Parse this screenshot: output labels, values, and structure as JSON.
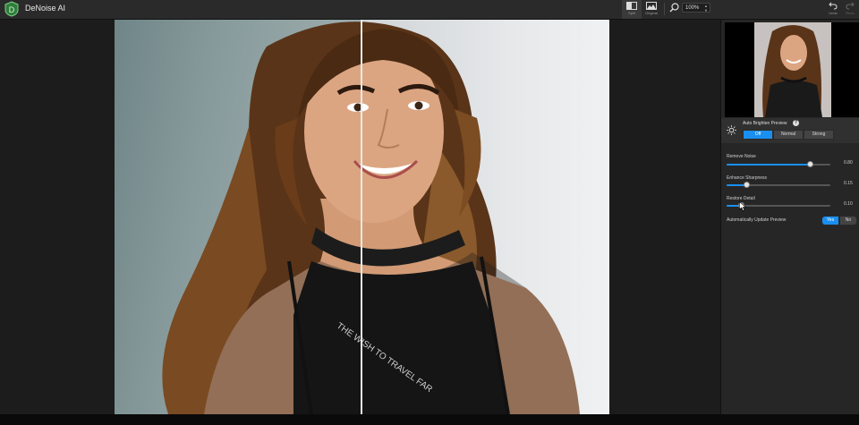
{
  "app": {
    "title": "DeNoise AI"
  },
  "toolbar": {
    "split_label": "Split",
    "original_label": "Original",
    "zoom_value": "100%",
    "undo_label": "Undo",
    "redo_label": "Redo"
  },
  "preview": {
    "shirt_text": "THE WISH TO TRAVEL FAR"
  },
  "panel": {
    "auto_brighten_label": "Auto Brighten Preview",
    "brighten_options": [
      "Off",
      "Normal",
      "Strong"
    ],
    "brighten_selected": "Off",
    "sliders": [
      {
        "label": "Remove Noise",
        "value": "0.80",
        "fraction": 0.8
      },
      {
        "label": "Enhance Sharpness",
        "value": "0.15",
        "fraction": 0.19
      },
      {
        "label": "Restore Detail",
        "value": "0.10",
        "fraction": 0.14
      }
    ],
    "auto_update_label": "Automatically Update Preview",
    "auto_update_yes": "Yes",
    "auto_update_no": "No"
  },
  "colors": {
    "accent": "#1b8ff0",
    "panel": "#262626",
    "toolbar": "#2a2a2a"
  }
}
